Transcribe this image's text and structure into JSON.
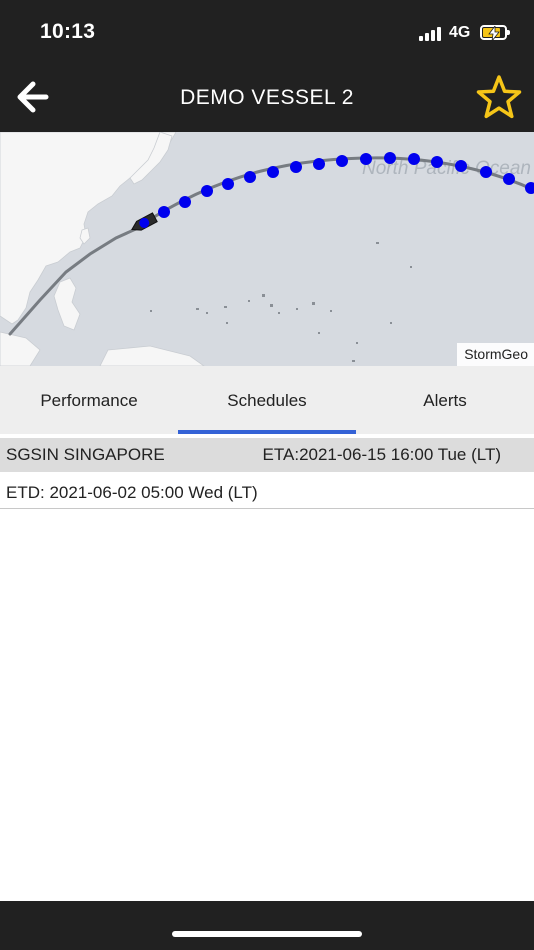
{
  "status_bar": {
    "time": "10:13",
    "network": "4G",
    "battery_state": "charging"
  },
  "header": {
    "title": "DEMO VESSEL 2",
    "back_icon": "arrow-left-icon",
    "favorite_icon": "star-outline-icon",
    "favorite_color": "#f5c518"
  },
  "map": {
    "ocean_label": "North Pacific Ocean",
    "attribution": "StormGeo",
    "route_point_color": "#0000ee"
  },
  "tabs": [
    {
      "label": "Performance",
      "active": false
    },
    {
      "label": "Schedules",
      "active": true
    },
    {
      "label": "Alerts",
      "active": false
    }
  ],
  "schedule": {
    "port": "SGSIN SINGAPORE",
    "eta": "ETA:2021-06-15 16:00 Tue (LT)",
    "etd": "ETD: 2021-06-02 05:00 Wed (LT)"
  },
  "accent_color": "#3462d6"
}
